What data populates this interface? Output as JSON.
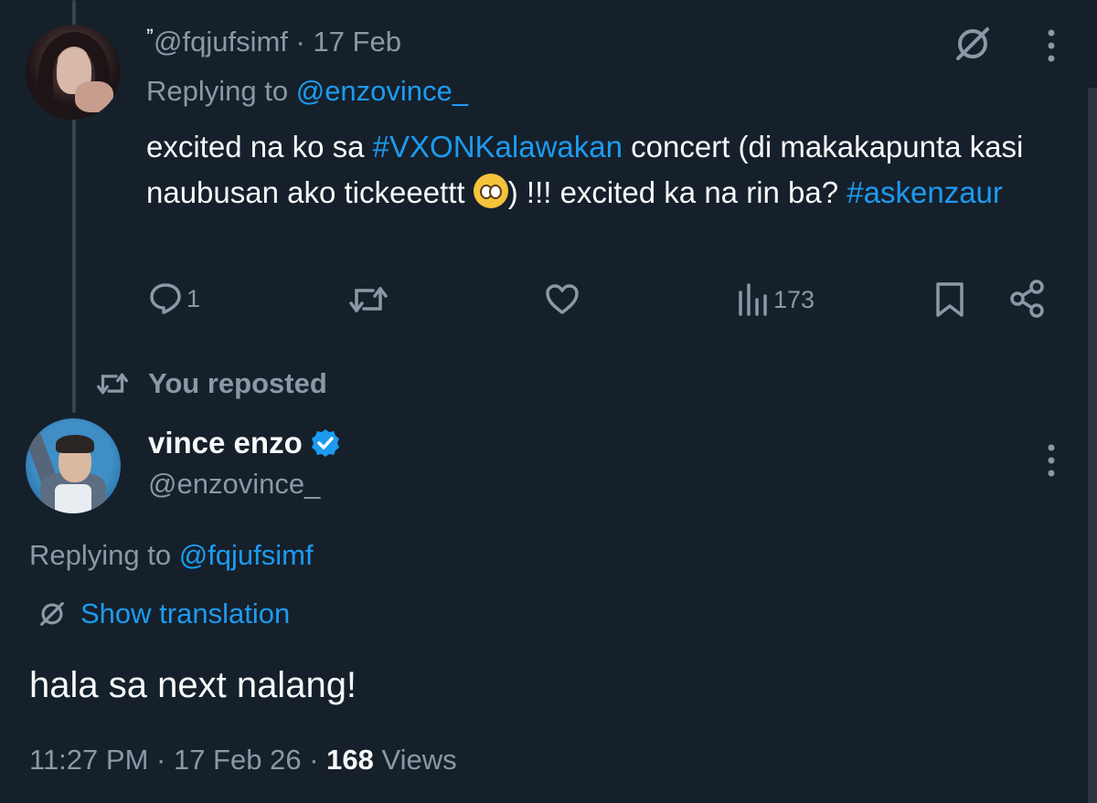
{
  "original_tweet": {
    "display_name_glyph": "ˮ",
    "handle": "@fqjufsimf",
    "date": "17 Feb",
    "replying_label": "Replying to",
    "replying_to": "@enzovince_",
    "body_part1": "excited na ko sa ",
    "hashtag1": "#VXONKalawakan",
    "body_part2": " concert (di makakapunta kasi naubusan ako tickeeettt ",
    "body_part3": ") !!! excited ka na rin ba? ",
    "hashtag2": "#askenzaur",
    "actions": {
      "reply_count": "1",
      "repost_count": "",
      "like_count": "",
      "views_count": "173"
    }
  },
  "repost_banner": {
    "label": "You reposted"
  },
  "reply_tweet": {
    "display_name": "vince enzo",
    "handle": "@enzovince_",
    "replying_label": "Replying to",
    "replying_to": "@fqjufsimf",
    "translation_label": "Show translation",
    "body": "hala sa next nalang!",
    "time": "11:27 PM",
    "date": "17 Feb 26",
    "views_count": "168",
    "views_label": "Views"
  },
  "colors": {
    "background": "#15202b",
    "accent": "#1d9bf0",
    "muted": "#8b98a5",
    "text": "#f7f9f9"
  }
}
